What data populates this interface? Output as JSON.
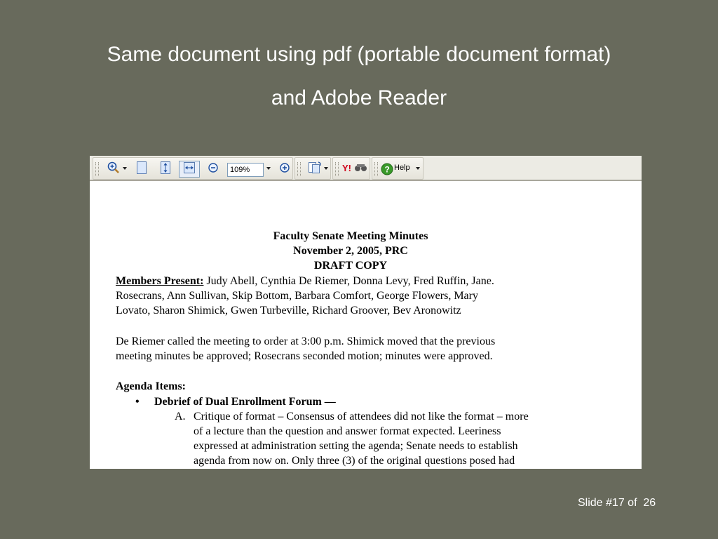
{
  "slide": {
    "title_line_1": "Same document using pdf (portable document format)",
    "title_line_2": "and Adobe Reader",
    "footer": "Slide #17 of  26"
  },
  "toolbar": {
    "zoom_value": "109%",
    "help_label": "Help",
    "icons": [
      "zoom-in-tool",
      "single-page",
      "fit-page",
      "fit-width",
      "zoom-out",
      "zoom-in",
      "page-display",
      "yahoo-search",
      "help"
    ]
  },
  "document": {
    "heading_1": "Faculty Senate Meeting Minutes",
    "heading_2": "November 2, 2005, PRC",
    "heading_3": "DRAFT COPY",
    "members_label": "Members Present:",
    "members_line_1": " Judy Abell, Cynthia De Riemer, Donna Levy, Fred Ruffin, Jane.",
    "members_line_2": "Rosecrans, Ann Sullivan,  Skip Bottom, Barbara Comfort, George Flowers,  Mary",
    "members_line_3": "Lovato, Sharon Shimick, Gwen Turbeville, Richard Groover, Bev Aronowitz",
    "para_line_1": "De Riemer called the meeting to order at 3:00 p.m.  Shimick moved that the previous",
    "para_line_2": "meeting minutes be approved; Rosecrans seconded motion; minutes were approved.",
    "agenda_label": "Agenda Items:",
    "bullet_symbol": "•",
    "bullet_1": "Debrief of Dual Enrollment Forum —",
    "item_a_marker": "A.",
    "item_a_line_1": "Critique of format – Consensus of attendees did not like the format – more",
    "item_a_line_2": "of a lecture than the question and answer format expected. Leeriness",
    "item_a_line_3": "expressed at administration setting the agenda; Senate needs to establish",
    "item_a_line_4": "agenda from now on. Only three (3) of the original questions posed had"
  },
  "colors": {
    "slide_background": "#686a5c",
    "toolbar_background": "#ecebe4",
    "yahoo_red": "#d0021b",
    "help_green": "#3a9a2a"
  }
}
